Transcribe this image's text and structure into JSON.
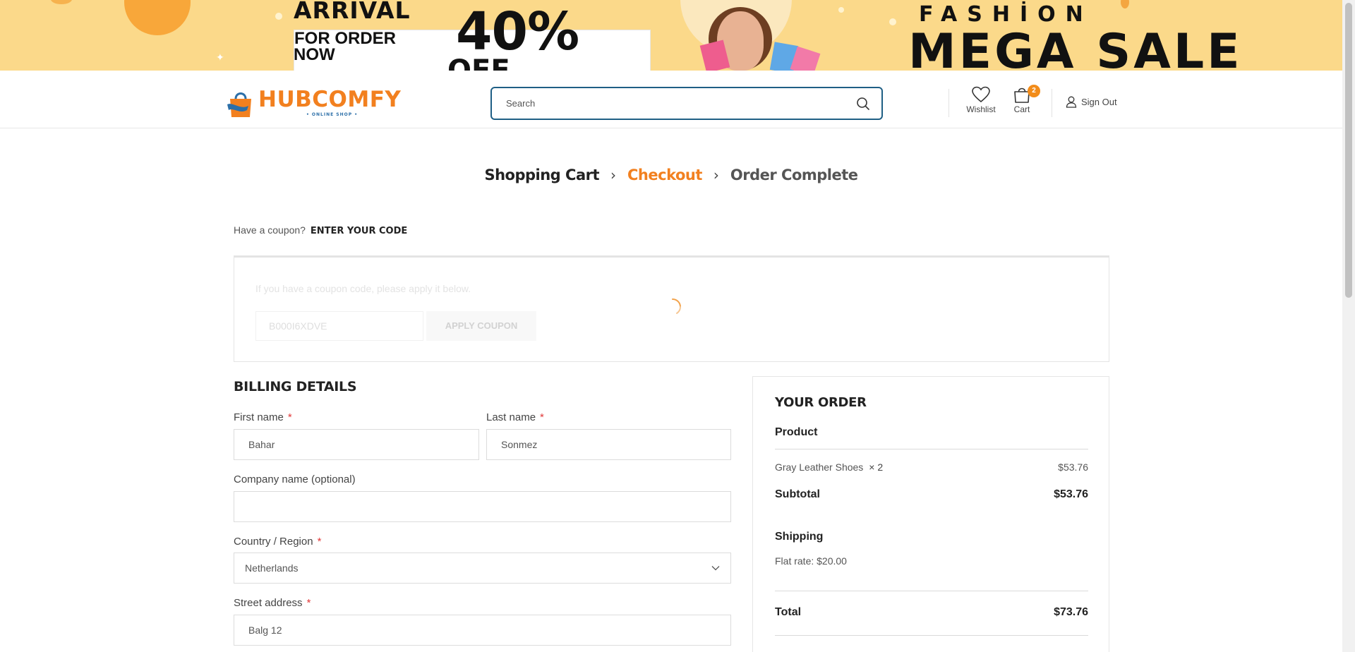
{
  "banner": {
    "arrival": "ARRİVAL",
    "for_order": "FOR ORDER",
    "now": "NOW",
    "percent": "40%",
    "off": "OFF",
    "fashion": "FASHİON",
    "mega_sale": "MEGA SALE"
  },
  "header": {
    "logo_text": "HUBCOMFY",
    "logo_subtitle": "• ONLINE SHOP •",
    "search_placeholder": "Search",
    "wishlist_label": "Wishlist",
    "cart_label": "Cart",
    "cart_count": "2",
    "signout_label": "Sign Out"
  },
  "steps": {
    "cart": "Shopping Cart",
    "checkout": "Checkout",
    "complete": "Order Complete"
  },
  "coupon": {
    "prompt": "Have a coupon?",
    "link": "ENTER YOUR CODE",
    "hint": "If you have a coupon code, please apply it below.",
    "code_value": "B000I6XDVE",
    "apply_label": "APPLY COUPON"
  },
  "billing": {
    "title": "BILLING DETAILS",
    "first_name_label": "First name",
    "first_name_value": "Bahar",
    "last_name_label": "Last name",
    "last_name_value": "Sonmez",
    "company_label": "Company name (optional)",
    "company_value": "",
    "country_label": "Country / Region",
    "country_value": "Netherlands",
    "street_label": "Street address",
    "street_value": "Balg 12",
    "required_mark": "*"
  },
  "order": {
    "title": "YOUR ORDER",
    "product_header": "Product",
    "item_name": "Gray Leather Shoes",
    "item_qty": "× 2",
    "item_price": "$53.76",
    "subtotal_label": "Subtotal",
    "subtotal_value": "$53.76",
    "shipping_label": "Shipping",
    "shipping_method": "Flat rate: $20.00",
    "total_label": "Total",
    "total_value": "$73.76"
  },
  "colors": {
    "accent": "#f2801f",
    "search_border": "#1f5f85",
    "banner_bg": "#fbd98a",
    "required": "#e23a3a"
  }
}
